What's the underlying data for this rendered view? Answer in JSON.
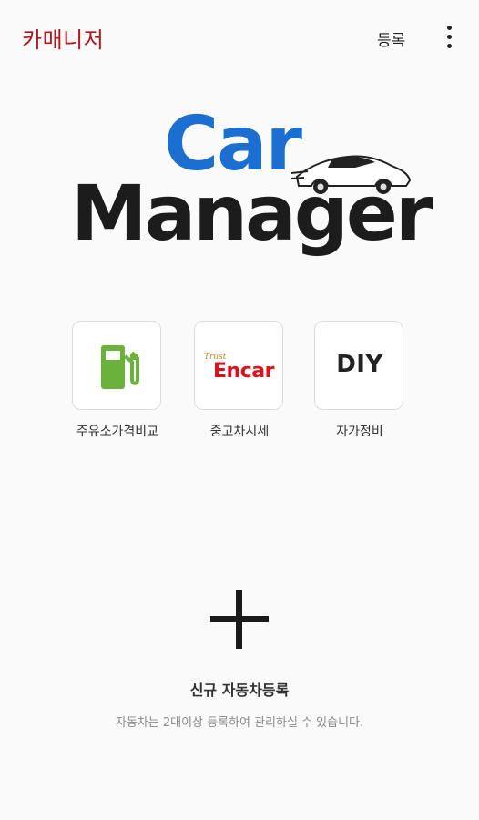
{
  "app_bar": {
    "title": "카매니저",
    "register_label": "등록",
    "more_icon": "more-vertical-icon",
    "title_color": "#b3161b"
  },
  "logo": {
    "line1": "Car",
    "line2": "Manager",
    "line1_color": "#1a6fd0",
    "line2_color": "#1c1c1c",
    "graphic": "sports-car-icon"
  },
  "quick_menu": [
    {
      "label": "주유소가격비교",
      "icon": "fuel-pump-icon",
      "icon_color": "#6ab23a"
    },
    {
      "label": "중고차시세",
      "icon": "encar-logo",
      "logo_small": "Trust",
      "logo_text": "Encar",
      "logo_color": "#d8131d"
    },
    {
      "label": "자가정비",
      "icon": "diy-icon",
      "logo_text": "DIY"
    }
  ],
  "add_vehicle": {
    "icon": "plus-icon",
    "title": "신규 자동차등록",
    "subtitle": "자동차는 2대이상 등록하여 관리하실 수 있습니다."
  }
}
